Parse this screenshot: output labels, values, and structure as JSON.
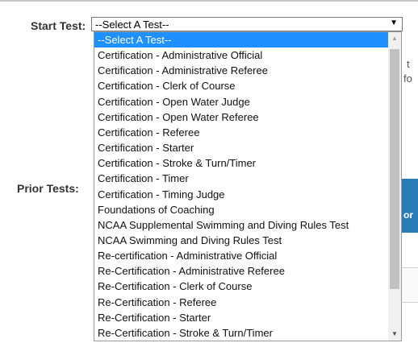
{
  "form": {
    "start_label": "Start Test:",
    "prior_label": "Prior Tests:"
  },
  "select": {
    "value": "--Select A Test--"
  },
  "dropdown": {
    "options": [
      "--Select A Test--",
      "Certification - Administrative Official",
      "Certification - Administrative Referee",
      "Certification - Clerk of Course",
      "Certification - Open Water Judge",
      "Certification - Open Water Referee",
      "Certification - Referee",
      "Certification - Starter",
      "Certification - Stroke & Turn/Timer",
      "Certification - Timer",
      "Certification - Timing Judge",
      "Foundations of Coaching",
      "NCAA Supplemental Swimming and Diving Rules Test",
      "NCAA Swimming and Diving Rules Test",
      "Re-certification - Administrative Official",
      "Re-Certification - Administrative Referee",
      "Re-Certification - Clerk of Course",
      "Re-Certification - Referee",
      "Re-Certification - Starter",
      "Re-Certification - Stroke & Turn/Timer"
    ],
    "selected_index": 0
  },
  "background": {
    "frag1": "t",
    "frag2": "fo",
    "blue_text": "or",
    "blue_color": "#2a7ab5"
  },
  "colors": {
    "selection": "#1e90ff"
  },
  "icons": {
    "select_arrow": "chevron-down-icon",
    "scroll_up": "triangle-up-icon",
    "scroll_down": "triangle-down-icon"
  }
}
